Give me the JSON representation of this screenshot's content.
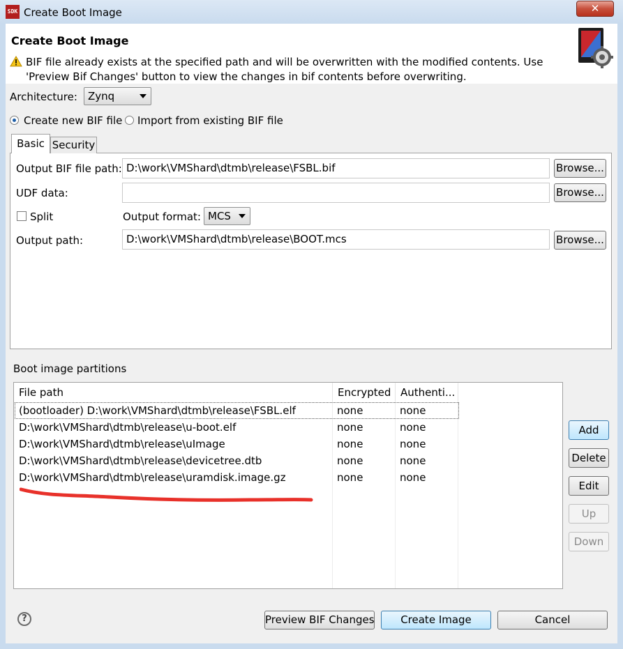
{
  "window": {
    "app_icon_text": "SDK",
    "title": "Create Boot Image",
    "close_glyph": "✕"
  },
  "header": {
    "title": "Create Boot Image",
    "warning": "BIF file already exists at the specified path and will be overwritten with the modified contents. Use 'Preview Bif Changes' button to view the changes in bif contents before overwriting."
  },
  "architecture": {
    "label": "Architecture:",
    "value": "Zynq"
  },
  "bif_mode": {
    "create_label": "Create new BIF file",
    "import_label": "Import from existing BIF file",
    "selected": "create"
  },
  "tabs": [
    {
      "label": "Basic",
      "active": true
    },
    {
      "label": "Security",
      "active": false
    }
  ],
  "basic": {
    "output_bif_label": "Output BIF file path:",
    "output_bif_value": "D:\\work\\VMShard\\dtmb\\release\\FSBL.bif",
    "udf_label": "UDF data:",
    "udf_value": "",
    "split_label": "Split",
    "split_checked": false,
    "output_format_label": "Output format:",
    "output_format_value": "MCS",
    "output_path_label": "Output path:",
    "output_path_value": "D:\\work\\VMShard\\dtmb\\release\\BOOT.mcs",
    "browse_label": "Browse..."
  },
  "partitions": {
    "section_label": "Boot image partitions",
    "columns": [
      "File path",
      "Encrypted",
      "Authenti..."
    ],
    "rows": [
      {
        "path": "(bootloader) D:\\work\\VMShard\\dtmb\\release\\FSBL.elf",
        "encrypted": "none",
        "auth": "none"
      },
      {
        "path": "D:\\work\\VMShard\\dtmb\\release\\u-boot.elf",
        "encrypted": "none",
        "auth": "none"
      },
      {
        "path": "D:\\work\\VMShard\\dtmb\\release\\uImage",
        "encrypted": "none",
        "auth": "none"
      },
      {
        "path": "D:\\work\\VMShard\\dtmb\\release\\devicetree.dtb",
        "encrypted": "none",
        "auth": "none"
      },
      {
        "path": "D:\\work\\VMShard\\dtmb\\release\\uramdisk.image.gz",
        "encrypted": "none",
        "auth": "none"
      }
    ],
    "buttons": {
      "add": "Add",
      "delete": "Delete",
      "edit": "Edit",
      "up": "Up",
      "down": "Down"
    },
    "annotation_color": "#e8312a"
  },
  "footer": {
    "help_glyph": "?",
    "preview_label": "Preview BIF Changes",
    "create_label": "Create Image",
    "cancel_label": "Cancel"
  }
}
